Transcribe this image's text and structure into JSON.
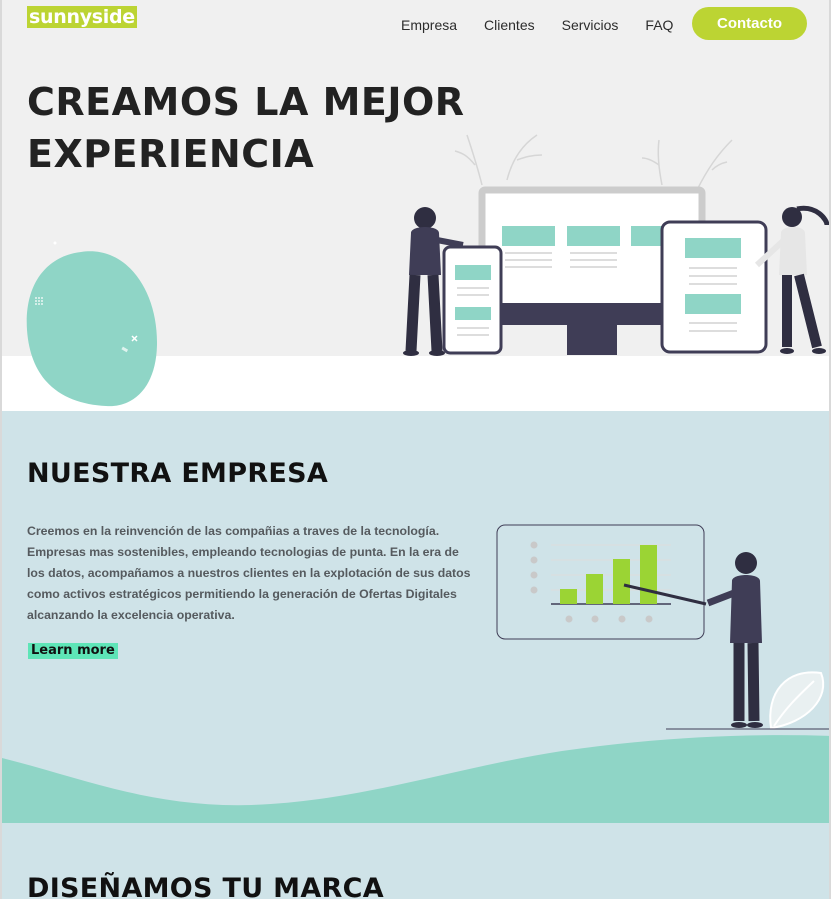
{
  "header": {
    "logo_text": "sunnyside",
    "nav": [
      {
        "label": "Empresa"
      },
      {
        "label": "Clientes"
      },
      {
        "label": "Servicios"
      },
      {
        "label": "FAQ"
      }
    ],
    "cta_label": "Contacto"
  },
  "hero": {
    "title_line1": "CREAMOS LA MEJOR",
    "title_line2": "EXPERIENCIA"
  },
  "empresa": {
    "title": "NUESTRA EMPRESA",
    "paragraph_lines": [
      "Creemos en la reinvención de las compañias a traves de la tecnología.",
      "Empresas mas sostenibles, empleando tecnologias de punta. En la era de",
      "los datos, acompañamos a nuestros clientes en la explotación de sus datos",
      "como activos estratégicos permitiendo la generación de Ofertas Digitales",
      "alcanzando la excelencia operativa."
    ],
    "learn_more": "Learn more"
  },
  "marca": {
    "title": "DISEÑAMOS TU MARCA"
  },
  "colors": {
    "brand_green": "#bcd433",
    "mint": "#8fd5c6",
    "section_bg": "#cfe3e8",
    "hero_bg": "#f0f0f0",
    "learn_more_bg": "#5ee5b7"
  }
}
